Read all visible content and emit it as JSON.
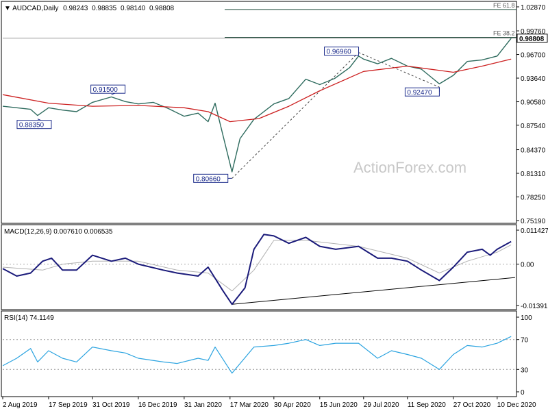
{
  "chart_data": [
    {
      "panel": "price",
      "type": "line",
      "title": "AUDCAD,Daily",
      "ohlc": [
        "0.98243",
        "0.98835",
        "0.98140",
        "0.98808"
      ],
      "watermark": "ActionForex.com",
      "y_ticks": [
        "1.02870",
        "0.99760",
        "0.96700",
        "0.93640",
        "0.90580",
        "0.87540",
        "0.84370",
        "0.81310",
        "0.78250",
        "0.75190"
      ],
      "ylim": [
        0.7519,
        1.0287
      ],
      "last_price": "0.98808",
      "fib_levels": [
        {
          "label": "FE 61.8",
          "value": 1.0253
        },
        {
          "label": "FE 38.2",
          "value": 0.9892
        }
      ],
      "pivot_labels": [
        {
          "label": "0.88350",
          "date": "2019-09-06",
          "value": 0.8835
        },
        {
          "label": "0.91500",
          "date": "2019-11-19",
          "value": 0.915
        },
        {
          "label": "0.80660",
          "date": "2020-03-19",
          "value": 0.8066
        },
        {
          "label": "0.96960",
          "date": "2020-07-24",
          "value": 0.9696
        },
        {
          "label": "0.92470",
          "date": "2020-10-13",
          "value": 0.9247
        }
      ],
      "close_series": [
        {
          "date": "2019-08-02",
          "value": 0.9
        },
        {
          "date": "2019-08-16",
          "value": 0.898
        },
        {
          "date": "2019-08-30",
          "value": 0.896
        },
        {
          "date": "2019-09-06",
          "value": 0.888
        },
        {
          "date": "2019-09-17",
          "value": 0.898
        },
        {
          "date": "2019-10-01",
          "value": 0.895
        },
        {
          "date": "2019-10-15",
          "value": 0.893
        },
        {
          "date": "2019-10-31",
          "value": 0.905
        },
        {
          "date": "2019-11-19",
          "value": 0.912
        },
        {
          "date": "2019-12-03",
          "value": 0.906
        },
        {
          "date": "2019-12-16",
          "value": 0.903
        },
        {
          "date": "2019-12-31",
          "value": 0.905
        },
        {
          "date": "2020-01-15",
          "value": 0.897
        },
        {
          "date": "2020-01-31",
          "value": 0.887
        },
        {
          "date": "2020-02-14",
          "value": 0.891
        },
        {
          "date": "2020-02-24",
          "value": 0.88
        },
        {
          "date": "2020-03-02",
          "value": 0.904
        },
        {
          "date": "2020-03-10",
          "value": 0.862
        },
        {
          "date": "2020-03-19",
          "value": 0.815
        },
        {
          "date": "2020-03-27",
          "value": 0.858
        },
        {
          "date": "2020-04-10",
          "value": 0.883
        },
        {
          "date": "2020-04-30",
          "value": 0.903
        },
        {
          "date": "2020-05-15",
          "value": 0.91
        },
        {
          "date": "2020-06-01",
          "value": 0.935
        },
        {
          "date": "2020-06-15",
          "value": 0.928
        },
        {
          "date": "2020-06-30",
          "value": 0.936
        },
        {
          "date": "2020-07-15",
          "value": 0.95
        },
        {
          "date": "2020-07-24",
          "value": 0.965
        },
        {
          "date": "2020-07-29",
          "value": 0.961
        },
        {
          "date": "2020-08-12",
          "value": 0.955
        },
        {
          "date": "2020-08-26",
          "value": 0.962
        },
        {
          "date": "2020-09-11",
          "value": 0.952
        },
        {
          "date": "2020-09-25",
          "value": 0.948
        },
        {
          "date": "2020-10-13",
          "value": 0.929
        },
        {
          "date": "2020-10-27",
          "value": 0.94
        },
        {
          "date": "2020-11-10",
          "value": 0.958
        },
        {
          "date": "2020-11-25",
          "value": 0.96
        },
        {
          "date": "2020-12-10",
          "value": 0.965
        },
        {
          "date": "2020-12-24",
          "value": 0.988
        }
      ],
      "ema_series": [
        {
          "date": "2019-08-02",
          "value": 0.915
        },
        {
          "date": "2019-09-17",
          "value": 0.904
        },
        {
          "date": "2019-10-31",
          "value": 0.9
        },
        {
          "date": "2019-12-16",
          "value": 0.901
        },
        {
          "date": "2020-01-31",
          "value": 0.898
        },
        {
          "date": "2020-02-24",
          "value": 0.893
        },
        {
          "date": "2020-03-17",
          "value": 0.88
        },
        {
          "date": "2020-04-15",
          "value": 0.884
        },
        {
          "date": "2020-05-15",
          "value": 0.9
        },
        {
          "date": "2020-06-15",
          "value": 0.92
        },
        {
          "date": "2020-07-29",
          "value": 0.945
        },
        {
          "date": "2020-09-11",
          "value": 0.952
        },
        {
          "date": "2020-10-27",
          "value": 0.944
        },
        {
          "date": "2020-11-25",
          "value": 0.952
        },
        {
          "date": "2020-12-24",
          "value": 0.961
        }
      ],
      "trendlines": [
        {
          "from": {
            "date": "2020-03-19",
            "value": 0.8066
          },
          "to": {
            "date": "2020-07-24",
            "value": 0.9696
          }
        },
        {
          "from": {
            "date": "2020-07-24",
            "value": 0.9696
          },
          "to": {
            "date": "2020-10-13",
            "value": 0.9247
          }
        }
      ]
    },
    {
      "panel": "macd",
      "type": "line",
      "title": "MACD(12,26,9) 0.007610 0.006535",
      "y_ticks": [
        "0.011427",
        "0.00",
        "-0.01391"
      ],
      "ylim": [
        -0.01391,
        0.011427
      ],
      "macd_series": [
        {
          "date": "2019-08-02",
          "value": -0.0015
        },
        {
          "date": "2019-08-16",
          "value": -0.004
        },
        {
          "date": "2019-08-30",
          "value": -0.003
        },
        {
          "date": "2019-09-11",
          "value": 0.001
        },
        {
          "date": "2019-09-20",
          "value": 0.002
        },
        {
          "date": "2019-10-01",
          "value": -0.002
        },
        {
          "date": "2019-10-15",
          "value": -0.002
        },
        {
          "date": "2019-10-31",
          "value": 0.003
        },
        {
          "date": "2019-11-19",
          "value": 0.001
        },
        {
          "date": "2019-12-03",
          "value": 0.002
        },
        {
          "date": "2019-12-16",
          "value": 0.0
        },
        {
          "date": "2020-01-10",
          "value": -0.002
        },
        {
          "date": "2020-01-24",
          "value": -0.003
        },
        {
          "date": "2020-02-14",
          "value": -0.004
        },
        {
          "date": "2020-02-24",
          "value": -0.001
        },
        {
          "date": "2020-03-10",
          "value": -0.009
        },
        {
          "date": "2020-03-19",
          "value": -0.0135
        },
        {
          "date": "2020-04-01",
          "value": -0.008
        },
        {
          "date": "2020-04-10",
          "value": 0.005
        },
        {
          "date": "2020-04-20",
          "value": 0.01
        },
        {
          "date": "2020-04-30",
          "value": 0.0095
        },
        {
          "date": "2020-05-15",
          "value": 0.007
        },
        {
          "date": "2020-06-01",
          "value": 0.009
        },
        {
          "date": "2020-06-15",
          "value": 0.006
        },
        {
          "date": "2020-07-01",
          "value": 0.005
        },
        {
          "date": "2020-07-24",
          "value": 0.006
        },
        {
          "date": "2020-08-12",
          "value": 0.002
        },
        {
          "date": "2020-08-26",
          "value": 0.002
        },
        {
          "date": "2020-09-11",
          "value": 0.001
        },
        {
          "date": "2020-09-25",
          "value": -0.002
        },
        {
          "date": "2020-10-13",
          "value": -0.0055
        },
        {
          "date": "2020-10-27",
          "value": -0.001
        },
        {
          "date": "2020-11-10",
          "value": 0.004
        },
        {
          "date": "2020-11-25",
          "value": 0.005
        },
        {
          "date": "2020-12-03",
          "value": 0.003
        },
        {
          "date": "2020-12-10",
          "value": 0.005
        },
        {
          "date": "2020-12-24",
          "value": 0.0076
        }
      ],
      "signal_series": [
        {
          "date": "2019-08-02",
          "value": -0.001
        },
        {
          "date": "2019-09-11",
          "value": -0.002
        },
        {
          "date": "2019-10-01",
          "value": 0.0
        },
        {
          "date": "2019-10-31",
          "value": 0.001
        },
        {
          "date": "2019-12-16",
          "value": 0.001
        },
        {
          "date": "2020-01-24",
          "value": -0.002
        },
        {
          "date": "2020-02-24",
          "value": -0.003
        },
        {
          "date": "2020-03-19",
          "value": -0.009
        },
        {
          "date": "2020-04-10",
          "value": -0.002
        },
        {
          "date": "2020-04-30",
          "value": 0.008
        },
        {
          "date": "2020-06-01",
          "value": 0.008
        },
        {
          "date": "2020-07-24",
          "value": 0.006
        },
        {
          "date": "2020-09-11",
          "value": 0.002
        },
        {
          "date": "2020-10-13",
          "value": -0.003
        },
        {
          "date": "2020-11-10",
          "value": 0.001
        },
        {
          "date": "2020-12-10",
          "value": 0.004
        },
        {
          "date": "2020-12-24",
          "value": 0.0065
        }
      ],
      "trendline": {
        "from": {
          "date": "2020-03-19",
          "value": -0.0135
        },
        "to": {
          "date": "2020-12-28",
          "value": -0.0045
        }
      }
    },
    {
      "panel": "rsi",
      "type": "line",
      "title": "RSI(14) 74.1149",
      "y_ticks": [
        "100",
        "70",
        "30",
        "0"
      ],
      "ylim": [
        0,
        100
      ],
      "reference_lines": [
        70,
        30
      ],
      "rsi_series": [
        {
          "date": "2019-08-02",
          "value": 35
        },
        {
          "date": "2019-08-16",
          "value": 45
        },
        {
          "date": "2019-08-30",
          "value": 58
        },
        {
          "date": "2019-09-06",
          "value": 40
        },
        {
          "date": "2019-09-17",
          "value": 55
        },
        {
          "date": "2019-10-01",
          "value": 45
        },
        {
          "date": "2019-10-15",
          "value": 40
        },
        {
          "date": "2019-10-31",
          "value": 60
        },
        {
          "date": "2019-11-19",
          "value": 55
        },
        {
          "date": "2019-12-03",
          "value": 52
        },
        {
          "date": "2019-12-16",
          "value": 45
        },
        {
          "date": "2020-01-10",
          "value": 40
        },
        {
          "date": "2020-01-24",
          "value": 38
        },
        {
          "date": "2020-02-14",
          "value": 45
        },
        {
          "date": "2020-02-24",
          "value": 42
        },
        {
          "date": "2020-03-02",
          "value": 60
        },
        {
          "date": "2020-03-19",
          "value": 25
        },
        {
          "date": "2020-04-10",
          "value": 60
        },
        {
          "date": "2020-04-30",
          "value": 62
        },
        {
          "date": "2020-05-15",
          "value": 65
        },
        {
          "date": "2020-06-01",
          "value": 70
        },
        {
          "date": "2020-06-15",
          "value": 62
        },
        {
          "date": "2020-07-01",
          "value": 65
        },
        {
          "date": "2020-07-24",
          "value": 65
        },
        {
          "date": "2020-08-12",
          "value": 45
        },
        {
          "date": "2020-08-26",
          "value": 55
        },
        {
          "date": "2020-09-11",
          "value": 50
        },
        {
          "date": "2020-09-25",
          "value": 45
        },
        {
          "date": "2020-10-13",
          "value": 30
        },
        {
          "date": "2020-10-27",
          "value": 50
        },
        {
          "date": "2020-11-10",
          "value": 62
        },
        {
          "date": "2020-11-25",
          "value": 60
        },
        {
          "date": "2020-12-10",
          "value": 65
        },
        {
          "date": "2020-12-24",
          "value": 74.1149
        }
      ]
    }
  ],
  "x_axis": {
    "start": "2019-08-02",
    "end": "2020-12-28",
    "ticks": [
      {
        "label": "2 Aug 2019",
        "date": "2019-08-02"
      },
      {
        "label": "17 Sep 2019",
        "date": "2019-09-17"
      },
      {
        "label": "31 Oct 2019",
        "date": "2019-10-31"
      },
      {
        "label": "16 Dec 2019",
        "date": "2019-12-16"
      },
      {
        "label": "31 Jan 2020",
        "date": "2020-01-31"
      },
      {
        "label": "17 Mar 2020",
        "date": "2020-03-17"
      },
      {
        "label": "30 Apr 2020",
        "date": "2020-04-30"
      },
      {
        "label": "15 Jun 2020",
        "date": "2020-06-15"
      },
      {
        "label": "29 Jul 2020",
        "date": "2020-07-29"
      },
      {
        "label": "11 Sep 2020",
        "date": "2020-09-11"
      },
      {
        "label": "27 Oct 2020",
        "date": "2020-10-27"
      },
      {
        "label": "10 Dec 2020",
        "date": "2020-12-10"
      }
    ]
  },
  "colors": {
    "price": "#2e6b5e",
    "ema": "#cc1f1f",
    "macd": "#1a1a7a",
    "signal": "#b0b0b0",
    "rsi": "#2aa3e0",
    "label_box": "#1a2a8a",
    "grid": "#000000",
    "watermark": "#c8c8c8"
  }
}
